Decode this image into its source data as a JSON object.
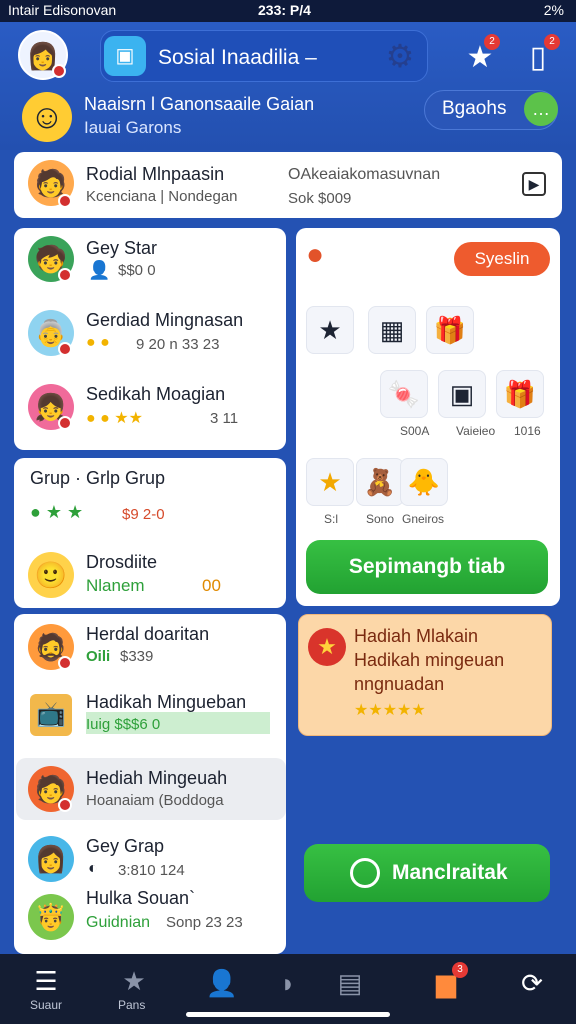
{
  "status_bar": {
    "left": "Intair Edisonovan",
    "time": "233: P/4",
    "right": "2%"
  },
  "header": {
    "app_title": "Sosial Inaadilia –",
    "line1": "Naaisrn l Ganonsaaile Gaian",
    "line2": "Iauai Garons",
    "pill_label": "Bgaohs",
    "badge_bell": "2",
    "badge_msg": "2"
  },
  "top_card": {
    "title": "Rodial Mlnpaasin",
    "subtitle": "Kcenciana | Nondegan",
    "right_title": "OAkeaiakomasuvnan",
    "right_sub": "Sok $009"
  },
  "friends": [
    {
      "name": "Gey Star",
      "detail": "$$0 0"
    },
    {
      "name": "Gerdiad Mingnasan",
      "detail": "9 20 n 33 23"
    },
    {
      "name": "Sedikah Moagian",
      "detail": "3 11"
    }
  ],
  "group": {
    "title": "Grup · Grlp Grup",
    "detail": "$9 2-0"
  },
  "group_member": {
    "name": "Drosdiite",
    "detail": "Nlanem",
    "value": "00"
  },
  "list2": [
    {
      "name": "Herdal doaritan",
      "detail": "Oili",
      "value": "$339"
    },
    {
      "name": "Hadikah Mingueban",
      "detail": "Iuig $$$6 0"
    },
    {
      "name": "Hediah Mingeuah",
      "detail": "Hoanaiam (Boddoga"
    },
    {
      "name": "Gey Grap",
      "detail": "3:810 124"
    },
    {
      "name": "Hulka Souan`",
      "detail": "Guidnian",
      "value": "Sonp 23 23"
    }
  ],
  "gifts": {
    "button": "Syeslin",
    "labels": [
      "S00A",
      "Vaieieo",
      "1016",
      "S:l",
      "Sono",
      "Gneiros"
    ],
    "send_button": "Sepimangb tiab"
  },
  "reward": {
    "line1": "Hadiah Mlakain",
    "line2": "Hadikah mingeuan",
    "line3": "nngnuadan"
  },
  "action_button": "Manclraitak",
  "nav": {
    "label1": "Suaur",
    "label2": "Pans",
    "badge": "3"
  }
}
